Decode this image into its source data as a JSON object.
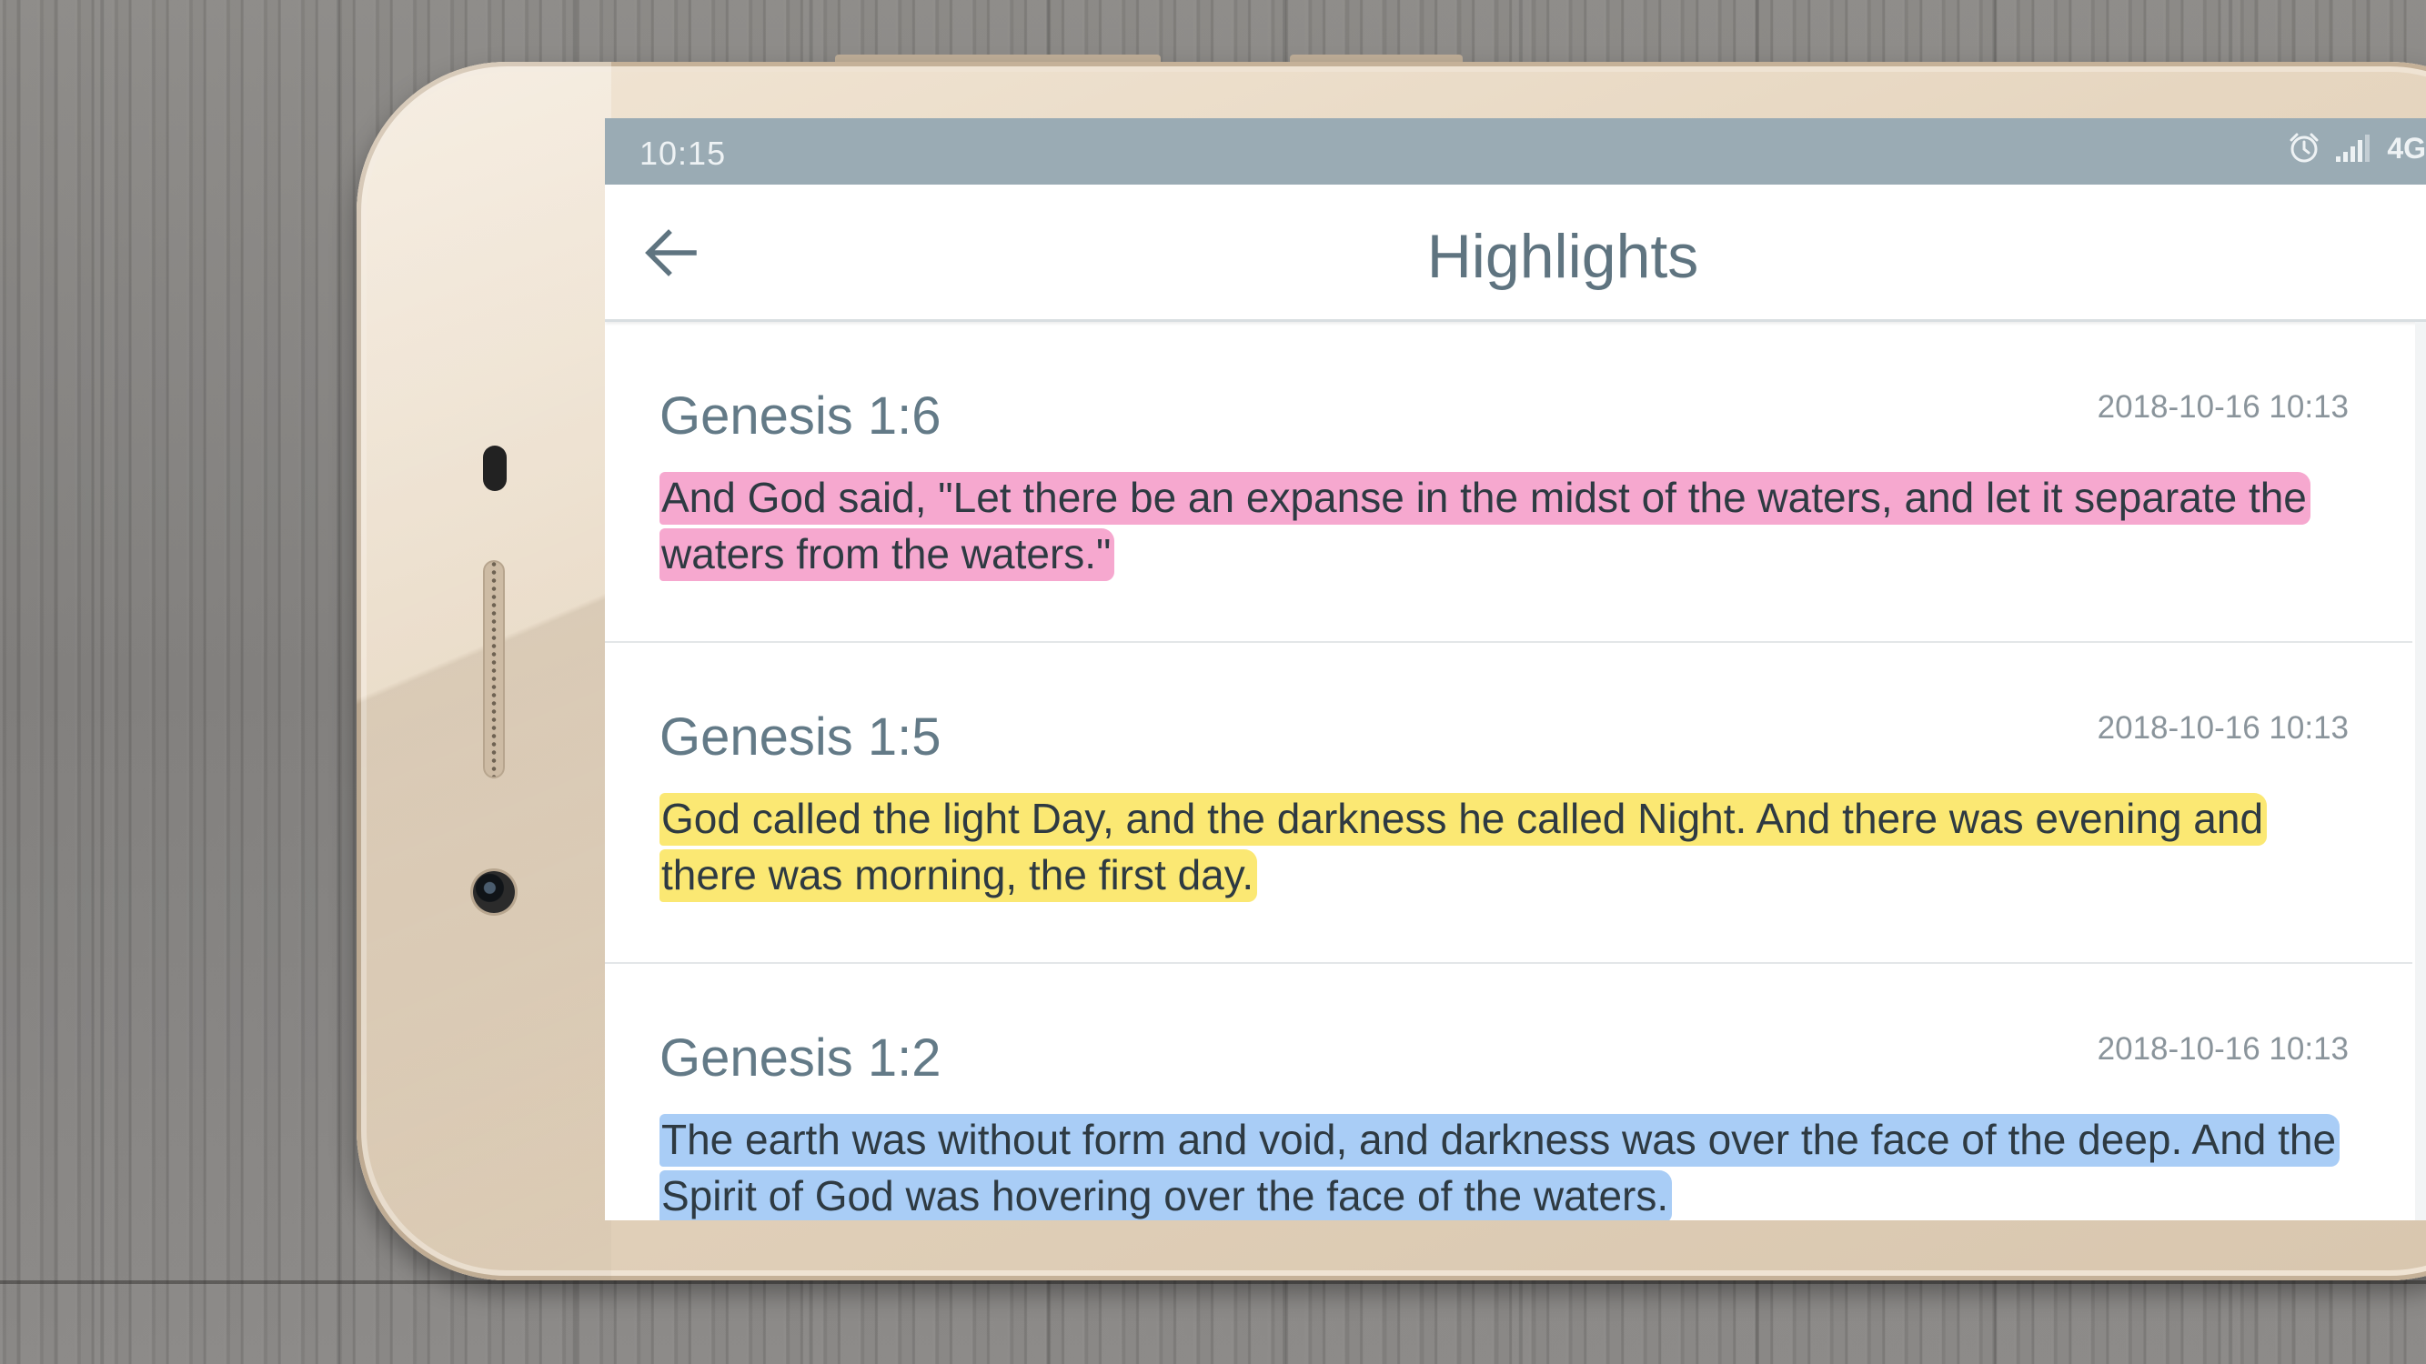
{
  "status_bar": {
    "time": "10:15",
    "network": "4G",
    "alarm_icon": "alarm-clock-icon",
    "signal_icon": "signal-bars-icon"
  },
  "app_bar": {
    "back_icon": "arrow-left-icon",
    "title": "Highlights"
  },
  "highlights": [
    {
      "reference": "Genesis 1:6",
      "date": "2018-10-16 10:13",
      "text": "And God said, \"Let there be an expanse in the midst of the waters, and let it separate the waters from the waters.\"",
      "color": "#f6a8cf"
    },
    {
      "reference": "Genesis 1:5",
      "date": "2018-10-16 10:13",
      "text": "God called the light Day, and the darkness he called Night. And there was evening and there was morning, the first day.",
      "color": "#fbe873"
    },
    {
      "reference": "Genesis 1:2",
      "date": "2018-10-16 10:13",
      "text": "The earth was without form and void, and darkness was over the face of the deep. And the Spirit of God was hovering over the face of the waters.",
      "color": "#a9cdf6"
    }
  ],
  "colors": {
    "status_bar": "#9aabb4",
    "title": "#5f7480",
    "phone_body": "#e6d6c0"
  }
}
